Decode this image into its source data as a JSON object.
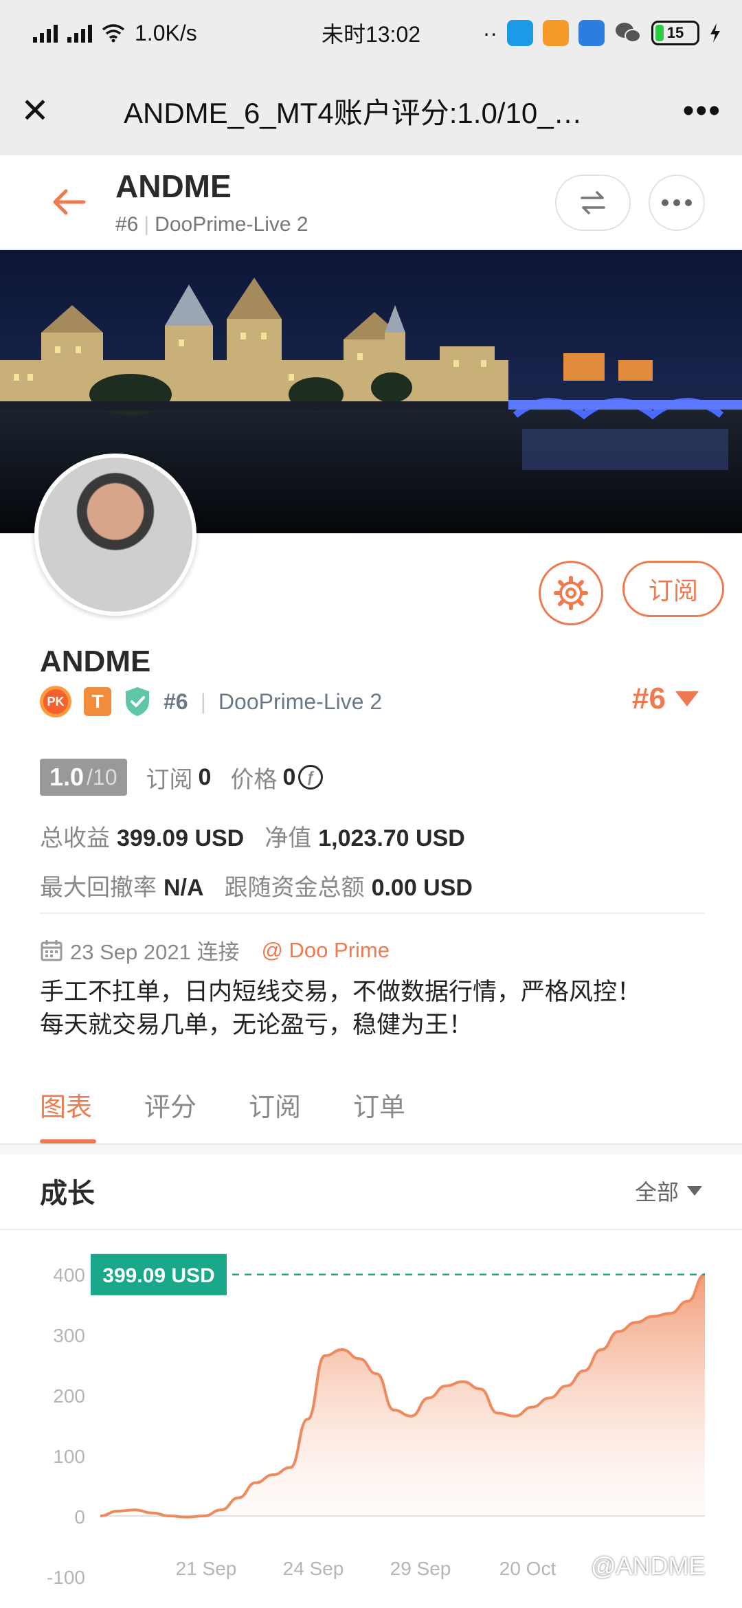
{
  "status_bar": {
    "network_speed": "1.0K/s",
    "time": "未时13:02",
    "dots": "··",
    "battery": "15"
  },
  "title_bar": {
    "title": "ANDME_6_MT4账户评分:1.0/10_…",
    "more": "•••"
  },
  "header": {
    "name": "ANDME",
    "rank": "#6",
    "broker": "DooPrime-Live 2"
  },
  "profile": {
    "subscribe_label": "订阅",
    "name": "ANDME",
    "badge_pk": "PK",
    "badge_t": "T",
    "rank": "#6",
    "broker": "DooPrime-Live 2",
    "rank_big": "#6",
    "score": "1.0",
    "score_max": "/10",
    "subscriptions_label": "订阅",
    "subscriptions_value": "0",
    "price_label": "价格",
    "price_value": "0",
    "total_profit_label": "总收益",
    "total_profit_value": "399.09 USD",
    "equity_label": "净值",
    "equity_value": "1,023.70 USD",
    "max_drawdown_label": "最大回撤率",
    "max_drawdown_value": "N/A",
    "follow_total_label": "跟随资金总额",
    "follow_total_value": "0.00 USD",
    "connected_date": "23 Sep 2021 连接",
    "connected_via": "@ Doo Prime",
    "bio_line1": "手工不扛单，日内短线交易，不做数据行情，严格风控！",
    "bio_line2": "每天就交易几单，无论盈亏，稳健为王！"
  },
  "tabs": [
    {
      "label": "图表",
      "active": true
    },
    {
      "label": "评分",
      "active": false
    },
    {
      "label": "订阅",
      "active": false
    },
    {
      "label": "订单",
      "active": false
    }
  ],
  "growth": {
    "title": "成长",
    "range": "全部"
  },
  "colors": {
    "accent": "#ef7a4f",
    "teal": "#1aa88a",
    "muted": "#888888"
  },
  "chart_data": {
    "type": "area",
    "title": "",
    "ylim": [
      -100,
      400
    ],
    "y_ticks": [
      "400",
      "300",
      "200",
      "100",
      "0",
      "-100"
    ],
    "x_ticks": [
      "21 Sep",
      "24 Sep",
      "29 Sep",
      "20 Oct"
    ],
    "current_value_label": "399.09 USD",
    "series": [
      {
        "values": [
          0,
          8,
          10,
          5,
          0,
          -2,
          0,
          10,
          30,
          55,
          68,
          80,
          160,
          265,
          275,
          260,
          235,
          175,
          165,
          195,
          215,
          222,
          210,
          170,
          165,
          180,
          195,
          215,
          240,
          275,
          305,
          320,
          330,
          335,
          355,
          399.09
        ]
      }
    ]
  },
  "watermark": "@ANDME"
}
